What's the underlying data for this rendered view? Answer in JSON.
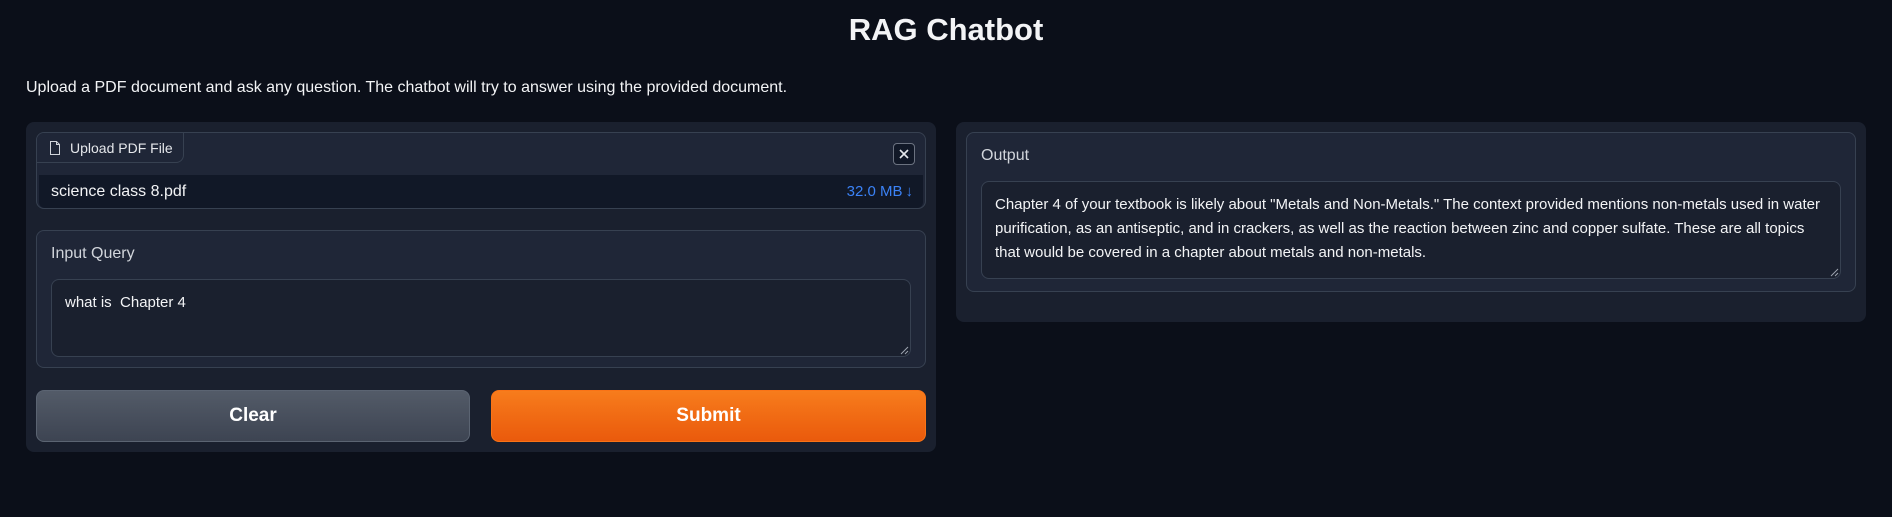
{
  "header": {
    "title": "RAG Chatbot",
    "description": "Upload a PDF document and ask any question. The chatbot will try to answer using the provided document."
  },
  "upload": {
    "label": "Upload PDF File",
    "file_name": "science class 8.pdf",
    "file_size": "32.0 MB",
    "download_glyph": "↓",
    "icons": [
      "file-icon",
      "close-icon",
      "download-icon"
    ]
  },
  "query": {
    "label": "Input Query",
    "value": "what is  Chapter 4"
  },
  "buttons": {
    "clear": "Clear",
    "submit": "Submit"
  },
  "output": {
    "label": "Output",
    "text": " Chapter 4 of your textbook is likely about \"Metals and Non-Metals.\" The context provided mentions non-metals used in water purification, as an antiseptic, and in crackers, as well as the reaction between zinc and copper sulfate. These are all topics that would be covered in a chapter about metals and non-metals."
  },
  "colors": {
    "background": "#0b0f19",
    "panel": "#1f2637",
    "accent": "#f97316",
    "link": "#3b82f6"
  }
}
